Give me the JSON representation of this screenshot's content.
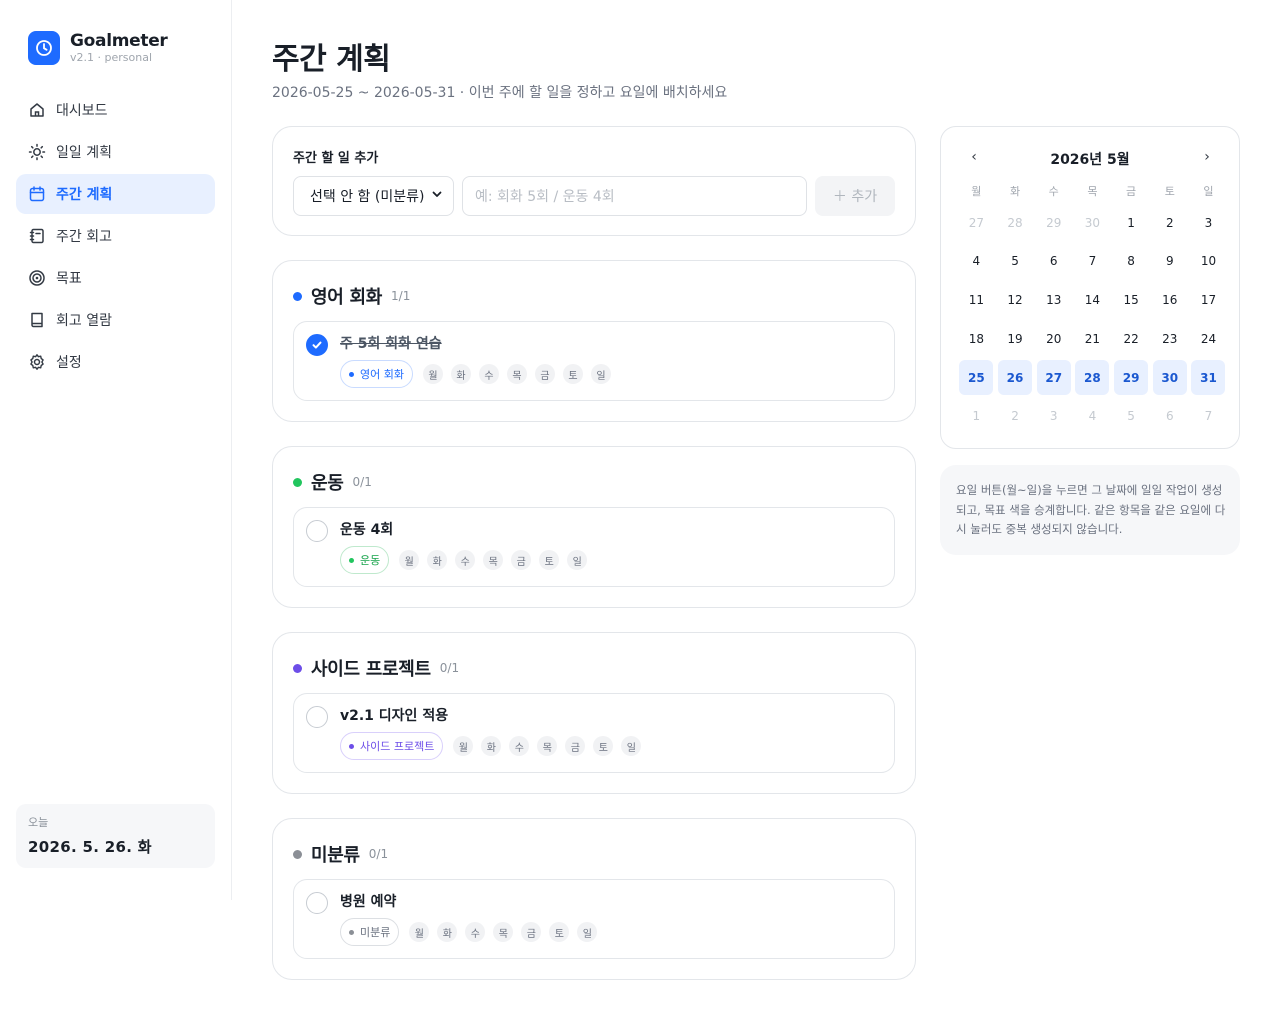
{
  "brand": {
    "name": "Goalmeter",
    "version": "v2.1 · personal"
  },
  "sidebar": {
    "items": [
      {
        "label": "대시보드",
        "icon": "home-icon"
      },
      {
        "label": "일일 계획",
        "icon": "sun-icon"
      },
      {
        "label": "주간 계획",
        "icon": "calendar-icon",
        "active": true
      },
      {
        "label": "주간 회고",
        "icon": "notebook-icon"
      },
      {
        "label": "목표",
        "icon": "target-icon"
      },
      {
        "label": "회고 열람",
        "icon": "book-icon"
      },
      {
        "label": "설정",
        "icon": "gear-icon"
      }
    ],
    "today_label": "오늘",
    "today_date": "2026. 5. 26. 화"
  },
  "header": {
    "title": "주간 계획",
    "subtitle": "2026-05-25 ~ 2026-05-31 · 이번 주에 할 일을 정하고 요일에 배치하세요"
  },
  "add_form": {
    "title": "주간 할 일 추가",
    "select_value": "선택 안 함 (미분류)",
    "input_placeholder": "예: 회화 5회 / 운동 4회",
    "add_label": "＋ 추가"
  },
  "weekdays": [
    "월",
    "화",
    "수",
    "목",
    "금",
    "토",
    "일"
  ],
  "groups": [
    {
      "name": "영어 회화",
      "count": "1/1",
      "color": "#1e6bff",
      "task": "주 5회 회화 연습",
      "done": true,
      "chip": "영어 회화",
      "chip_border": "#c9dbff",
      "chip_text": "#1e6bff"
    },
    {
      "name": "운동",
      "count": "0/1",
      "color": "#22c55e",
      "task": "운동 4회",
      "done": false,
      "chip": "운동",
      "chip_border": "#bfe9cd",
      "chip_text": "#16a34a"
    },
    {
      "name": "사이드 프로젝트",
      "count": "0/1",
      "color": "#6d4ee8",
      "task": "v2.1 디자인 적용",
      "done": false,
      "chip": "사이드 프로젝트",
      "chip_border": "#d9d0fb",
      "chip_text": "#6d4ee8"
    },
    {
      "name": "미분류",
      "count": "0/1",
      "color": "#8b8f96",
      "task": "병원 예약",
      "done": false,
      "chip": "미분류",
      "chip_border": "#dcdfe3",
      "chip_text": "#6b7280"
    }
  ],
  "calendar": {
    "title": "2026년 5월",
    "prev": "‹",
    "next": "›",
    "dow": [
      "월",
      "화",
      "수",
      "목",
      "금",
      "토",
      "일"
    ],
    "weeks": [
      [
        [
          "27",
          1
        ],
        [
          "28",
          1
        ],
        [
          "29",
          1
        ],
        [
          "30",
          1
        ],
        [
          "1",
          0
        ],
        [
          "2",
          0
        ],
        [
          "3",
          0
        ]
      ],
      [
        [
          "4",
          0
        ],
        [
          "5",
          0
        ],
        [
          "6",
          0
        ],
        [
          "7",
          0
        ],
        [
          "8",
          0
        ],
        [
          "9",
          0
        ],
        [
          "10",
          0
        ]
      ],
      [
        [
          "11",
          0
        ],
        [
          "12",
          0
        ],
        [
          "13",
          0
        ],
        [
          "14",
          0
        ],
        [
          "15",
          0
        ],
        [
          "16",
          0
        ],
        [
          "17",
          0
        ]
      ],
      [
        [
          "18",
          0
        ],
        [
          "19",
          0
        ],
        [
          "20",
          0
        ],
        [
          "21",
          0
        ],
        [
          "22",
          0
        ],
        [
          "23",
          0
        ],
        [
          "24",
          0
        ]
      ],
      [
        [
          "25",
          2
        ],
        [
          "26",
          2
        ],
        [
          "27",
          2
        ],
        [
          "28",
          2
        ],
        [
          "29",
          2
        ],
        [
          "30",
          2
        ],
        [
          "31",
          2
        ]
      ],
      [
        [
          "1",
          1
        ],
        [
          "2",
          1
        ],
        [
          "3",
          1
        ],
        [
          "4",
          1
        ],
        [
          "5",
          1
        ],
        [
          "6",
          1
        ],
        [
          "7",
          1
        ]
      ]
    ],
    "note": "요일 버튼(월~일)을 누르면 그 날짜에 일일 작업이 생성되고, 목표 색을 승계합니다. 같은 항목을 같은 요일에 다시 눌러도 중복 생성되지 않습니다."
  }
}
